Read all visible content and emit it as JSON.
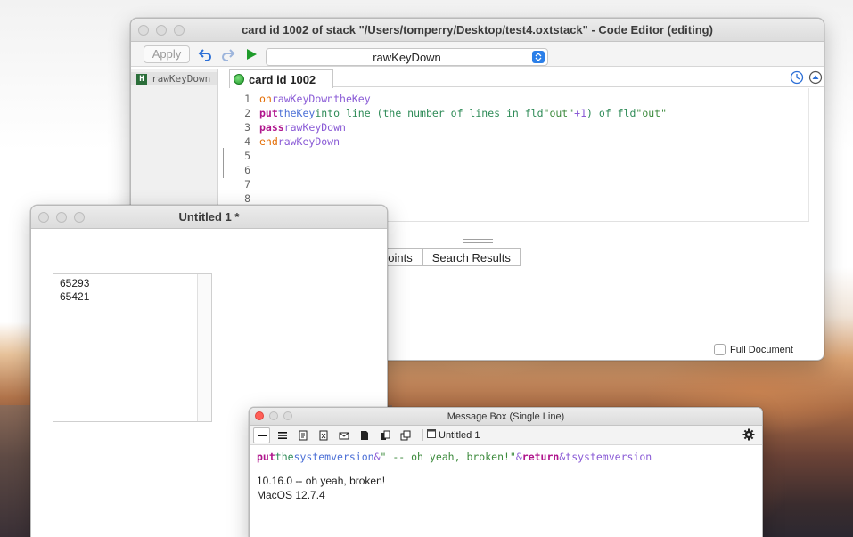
{
  "editor": {
    "title": "card id 1002 of stack \"/Users/tomperry/Desktop/test4.oxtstack\" - Code Editor (editing)",
    "apply_label": "Apply",
    "handler_selected": "rawKeyDown",
    "sidebar_item": "rawKeyDown",
    "sidebar_badge": "H",
    "card_tab": "card id 1002",
    "line_numbers": [
      "1",
      "2",
      "3",
      "4",
      "5",
      "6",
      "7",
      "8"
    ],
    "code": {
      "l1_on": "on",
      "l1_name": "rawKeyDown",
      "l1_param": "theKey",
      "l2_put": "put",
      "l2_var": "theKey",
      "l2_into": "into line (the number of lines in fld",
      "l2_str1": "\"out\"",
      "l2_plus": "+1",
      "l2_of": ") of fld",
      "l2_str2": "\"out\"",
      "l3_pass": "pass",
      "l3_name": "rawKeyDown",
      "l4_end": "end",
      "l4_name": "rawKeyDown"
    },
    "bottom_tabs": [
      "points",
      "Search Results"
    ],
    "full_document_label": "Full Document"
  },
  "untitled": {
    "title": "Untitled 1 *",
    "field_lines": [
      "65293",
      "65421"
    ]
  },
  "msgbox": {
    "title": "Message Box (Single Line)",
    "stack_name": "Untitled 1",
    "input": {
      "put": "put",
      "the": "the",
      "fn": "systemversion",
      "amp1": "&",
      "str": "\" -- oh yeah, broken!\"",
      "amp2": "&",
      "ret": "return",
      "amp3": "&",
      "var": "tsystemversion"
    },
    "result_lines": [
      "10.16.0 -- oh yeah, broken!",
      "MacOS 12.7.4"
    ]
  }
}
